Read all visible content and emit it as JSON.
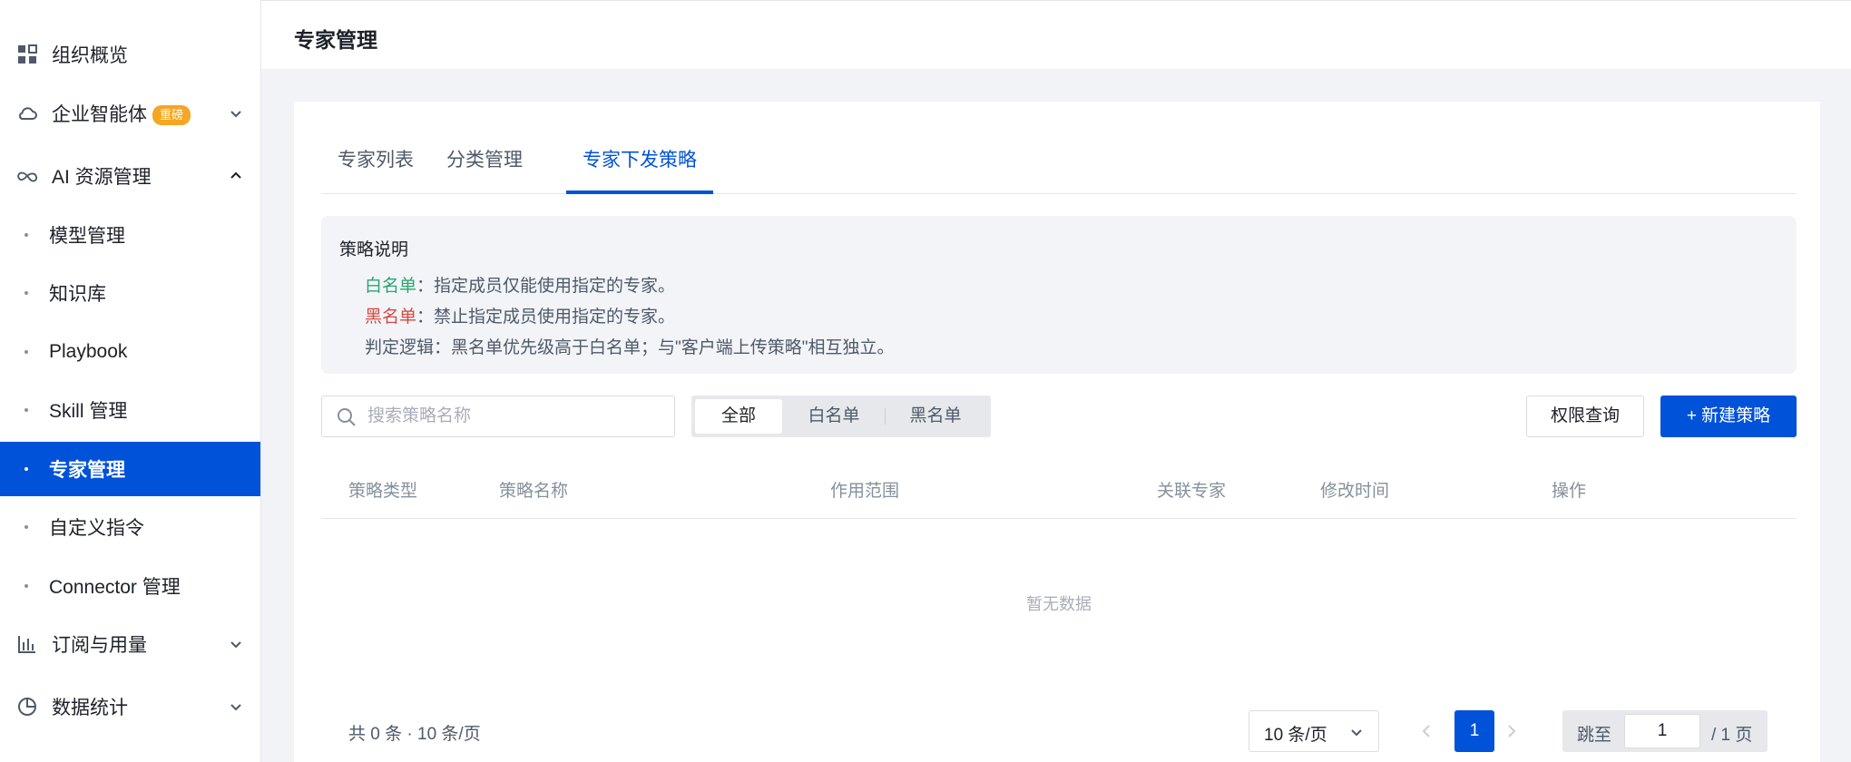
{
  "sidebar": {
    "items": [
      {
        "label": "组织概览",
        "icon": "grid-icon"
      },
      {
        "label": "企业智能体",
        "badge": "重磅",
        "icon": "cloud-icon",
        "expanded": false
      },
      {
        "label": "AI 资源管理",
        "icon": "infinity-icon",
        "expanded": true
      },
      {
        "label": "订阅与用量",
        "icon": "bar-chart-icon",
        "expanded": false
      },
      {
        "label": "数据统计",
        "icon": "pie-chart-icon",
        "expanded": false
      }
    ],
    "sub_items": [
      {
        "label": "模型管理"
      },
      {
        "label": "知识库"
      },
      {
        "label": "Playbook"
      },
      {
        "label": "Skill 管理"
      },
      {
        "label": "专家管理",
        "active": true
      },
      {
        "label": "自定义指令"
      },
      {
        "label": "Connector 管理"
      }
    ]
  },
  "header": {
    "title": "专家管理"
  },
  "tabs": [
    {
      "label": "专家列表"
    },
    {
      "label": "分类管理"
    },
    {
      "label": "专家下发策略",
      "active": true
    }
  ],
  "notice": {
    "title": "策略说明",
    "whitelist_label": "白名单",
    "whitelist_text": "：指定成员仅能使用指定的专家。",
    "blacklist_label": "黑名单",
    "blacklist_text": "：禁止指定成员使用指定的专家。",
    "logic_text": "判定逻辑：黑名单优先级高于白名单；与\"客户端上传策略\"相互独立。"
  },
  "search": {
    "placeholder": "搜索策略名称",
    "value": ""
  },
  "filter": {
    "options": [
      {
        "label": "全部",
        "active": true
      },
      {
        "label": "白名单"
      },
      {
        "label": "黑名单"
      }
    ]
  },
  "actions": {
    "query_label": "权限查询",
    "create_label": "+ 新建策略"
  },
  "table": {
    "columns": [
      "策略类型",
      "策略名称",
      "作用范围",
      "关联专家",
      "修改时间",
      "操作"
    ],
    "rows": [],
    "empty_text": "暂无数据"
  },
  "pagination": {
    "total_text": "共 0 条 · 10 条/页",
    "page_size": "10 条/页",
    "current_page": "1",
    "jump_label": "跳至",
    "jump_value": "1",
    "pages_text": "/ 1 页"
  },
  "colors": {
    "primary": "#0052d9",
    "whitelist": "#2ba471",
    "blacklist": "#d54941",
    "badge": "#f5a623"
  }
}
